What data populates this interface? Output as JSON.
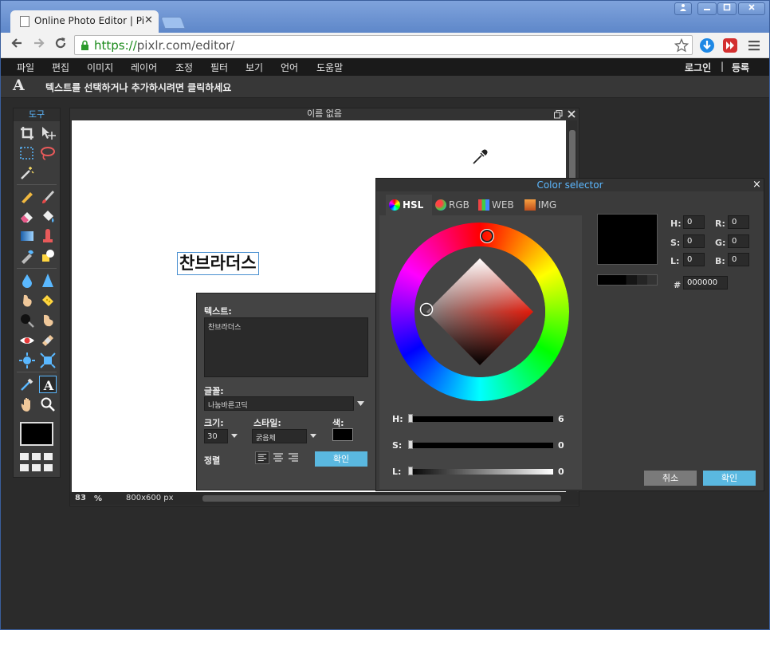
{
  "browser": {
    "tab_title": "Online Photo Editor | Pi",
    "tab_close": "✕",
    "url_scheme": "https://",
    "url_rest": "pixlr.com/editor/"
  },
  "app": {
    "menu": [
      "파일",
      "편집",
      "이미지",
      "레이어",
      "조정",
      "필터",
      "보기",
      "언어",
      "도움말"
    ],
    "login": "로그인",
    "divider": "|",
    "register": "등록",
    "tool_glyph": "A",
    "hint": "텍스트를 선택하거나 추가하시려면 클릭하세요",
    "toolbox_title": "도구"
  },
  "document": {
    "title": "이름 없음",
    "canvas_text": "찬브라더스",
    "zoom": "83",
    "zoom_unit": "%",
    "size": "800x600 px"
  },
  "text_dialog": {
    "text_label": "텍스트:",
    "text_value": "찬브라더스",
    "font_label": "글꼴:",
    "font_value": "나눔바른고딕",
    "size_label": "크기:",
    "size_value": "30",
    "style_label": "스타일:",
    "style_value": "굵음체",
    "color_label": "색:",
    "align_label": "정렬",
    "ok_button": "확인"
  },
  "color_selector": {
    "title": "Color selector",
    "close": "×",
    "tabs": [
      "HSL",
      "RGB",
      "WEB",
      "IMG"
    ],
    "active_tab": "HSL",
    "sliders": [
      {
        "label": "H:",
        "value": "6"
      },
      {
        "label": "S:",
        "value": "0"
      },
      {
        "label": "L:",
        "value": "0"
      }
    ],
    "hsl_fields": [
      {
        "label": "H:",
        "value": "0"
      },
      {
        "label": "S:",
        "value": "0"
      },
      {
        "label": "L:",
        "value": "0"
      }
    ],
    "rgb_fields": [
      {
        "label": "R:",
        "value": "0"
      },
      {
        "label": "G:",
        "value": "0"
      },
      {
        "label": "B:",
        "value": "0"
      }
    ],
    "hex_label": "#",
    "hex_value": "000000",
    "cancel_button": "취소",
    "ok_button": "확인",
    "current_color": "#000000"
  },
  "colors": {
    "accent": "#5ab8e0",
    "button_gray": "#7a7a7a"
  }
}
